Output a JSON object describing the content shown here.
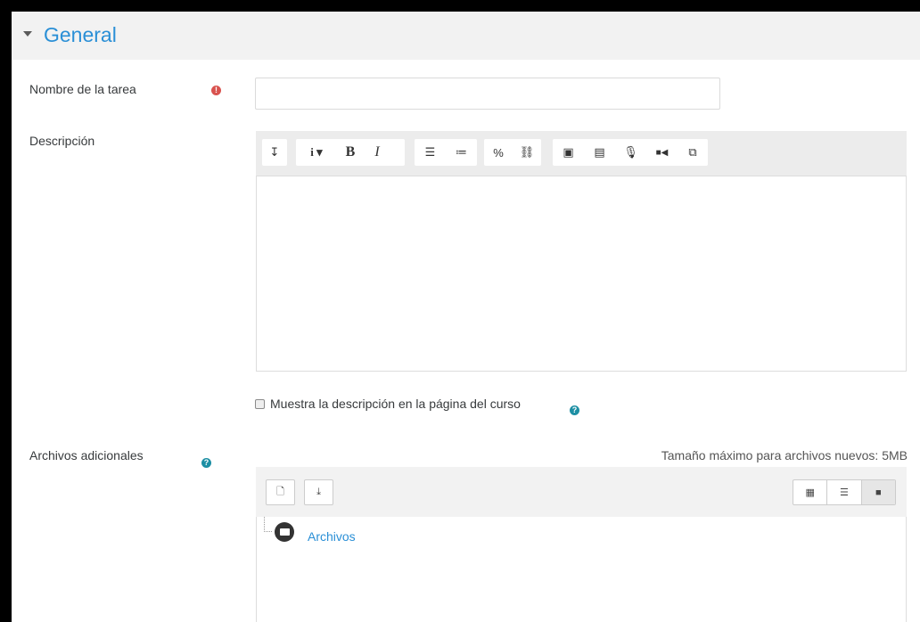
{
  "section": {
    "title": "General",
    "expanded": true
  },
  "fields": {
    "name": {
      "label": "Nombre de la tarea",
      "required_icon": "exclamation-circle",
      "value": ""
    },
    "description": {
      "label": "Descripción",
      "toolbar_icons": [
        "collapse",
        "paragraph-style",
        "bold",
        "italic",
        "unordered-list",
        "ordered-list",
        "link",
        "unlink",
        "image",
        "media",
        "record-audio",
        "record-video",
        "manage-files"
      ],
      "toolbar_glyphs": {
        "collapse": "↧",
        "style": "i ▾",
        "bold": "B",
        "italic": "I",
        "ul": "☰",
        "ol": "≔",
        "link": "%",
        "unlink": "⛓",
        "image": "▣",
        "media": "▤",
        "audio": "🎙",
        "video": "■◀",
        "files": "⧉"
      },
      "content": ""
    },
    "show_description": {
      "label": "Muestra la descripción en la página del curso",
      "checked": false
    },
    "additional_files": {
      "label": "Archivos adicionales",
      "max_size_text": "Tamaño máximo para archivos nuevos: 5MB",
      "folder_label": "Archivos",
      "icons": [
        "add-file",
        "download",
        "view-icons",
        "view-list",
        "view-tree"
      ],
      "glyphs": {
        "add": "🗋",
        "download": "⤓",
        "icons": "▦",
        "list": "☰",
        "tree": "■"
      },
      "active_view": "tree"
    }
  },
  "help_glyph": "?",
  "required_glyph": "!",
  "colors": {
    "accent": "#2a8fd6",
    "required": "#d9534f",
    "help": "#1d8fa4"
  }
}
